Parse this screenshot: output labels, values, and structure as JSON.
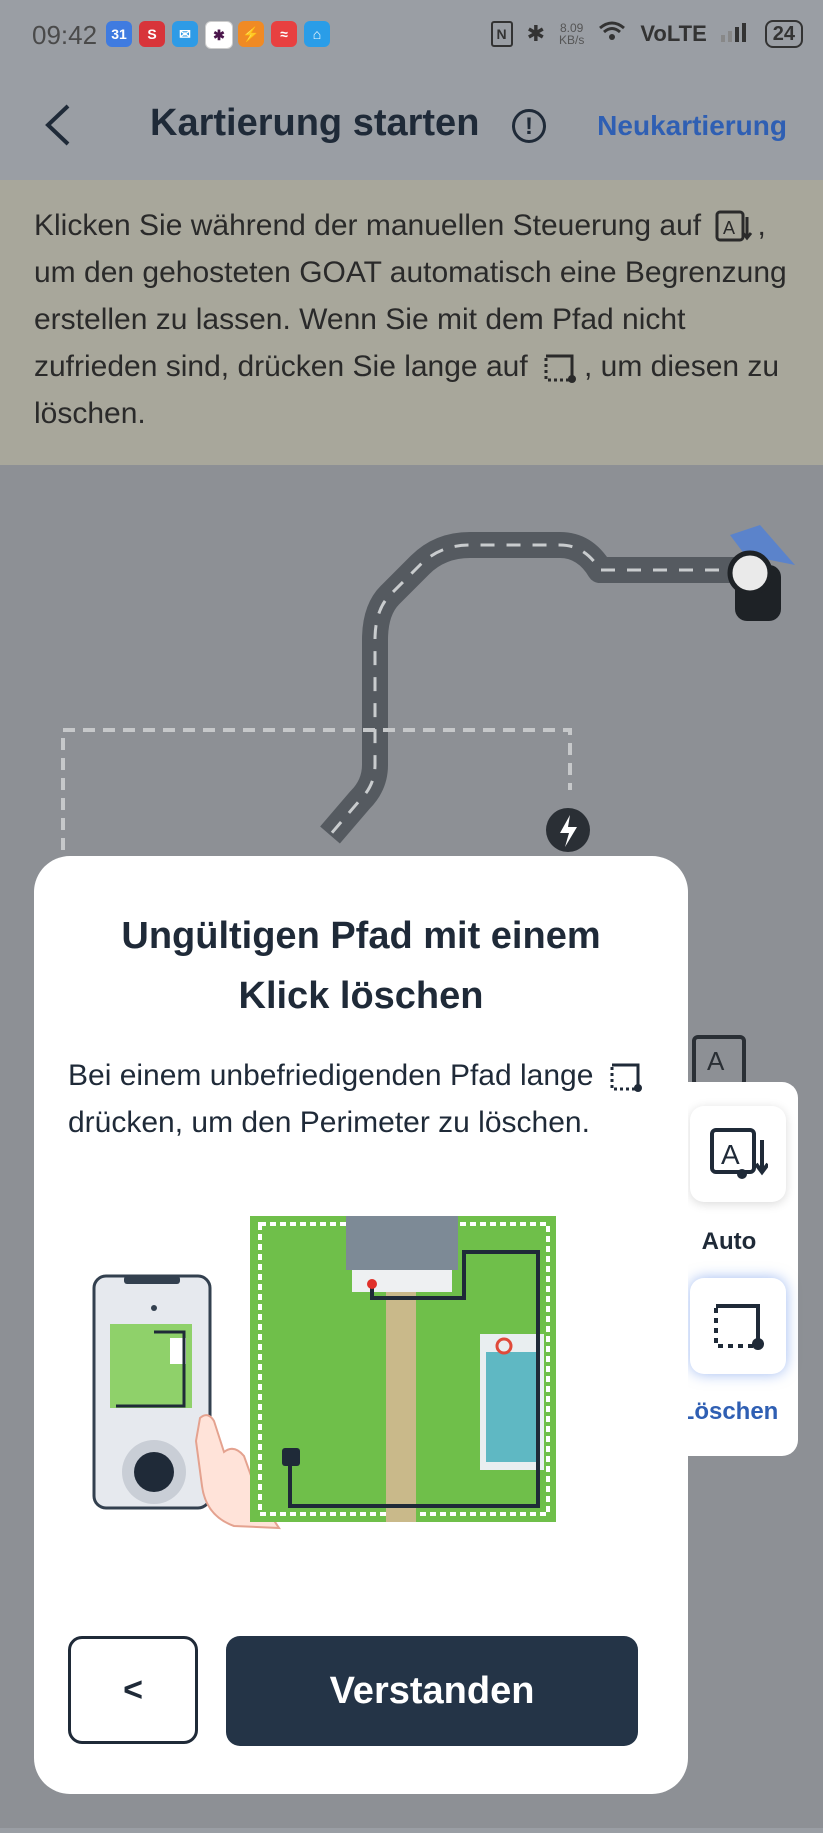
{
  "status_bar": {
    "time": "09:42",
    "apps": [
      {
        "icon": "calendar-icon",
        "text": "31",
        "color": "#3f7be0"
      },
      {
        "icon": "s-app-icon",
        "text": "S",
        "color": "#d8343a"
      },
      {
        "icon": "mail-icon",
        "text": "✉",
        "color": "#2e9be6"
      },
      {
        "icon": "slack-icon",
        "text": "✱",
        "color": "#ffffff"
      },
      {
        "icon": "app-orange-icon",
        "text": "⚡",
        "color": "#f08a24"
      },
      {
        "icon": "app-red-icon",
        "text": "≈",
        "color": "#e84040"
      },
      {
        "icon": "home-app-icon",
        "text": "⌂",
        "color": "#2a9de8"
      }
    ],
    "net_speed_value": "8.09",
    "net_speed_unit": "KB/s",
    "network_label": "VoLTE",
    "battery": "24"
  },
  "header": {
    "title": "Kartierung starten",
    "info_symbol": "!",
    "action_label": "Neukartierung"
  },
  "instruction": {
    "part1": "Klicken Sie während der manuellen Steuerung auf",
    "part2": ", um den gehosteten GOAT automatisch eine Begrenzung erstellen zu lassen. Wenn Sie mit dem Pfad nicht zufrieden sind, drücken Sie lange auf",
    "part3": ", um diesen zu löschen."
  },
  "side_panel": {
    "auto_label": "Auto",
    "delete_label": "Löschen"
  },
  "modal": {
    "title": "Ungültigen Pfad mit einem Klick löschen",
    "body_part1": "Bei einem unbefriedigenden Pfad lange",
    "body_part2": "drücken, um den Perimeter zu löschen.",
    "back_label": "<",
    "confirm_label": "Verstanden"
  },
  "colors": {
    "accent_blue": "#2f5fb3",
    "dark_button": "#243447",
    "lawn_green": "#6fbf4a"
  }
}
